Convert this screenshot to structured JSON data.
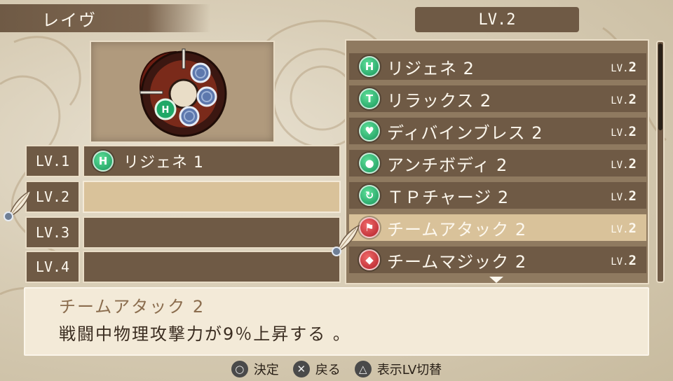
{
  "header": {
    "character_name": "レイヴ",
    "display_level": "LV.2"
  },
  "emblem": {
    "name": "skill-emblem",
    "slot_icon": "H"
  },
  "level_slots": [
    {
      "level": "LV.1",
      "skill": "リジェネ 1",
      "icon": "H",
      "icon_color": "#1fa866"
    },
    {
      "level": "LV.2",
      "skill": "",
      "icon": "",
      "selected": true
    },
    {
      "level": "LV.3",
      "skill": "",
      "icon": ""
    },
    {
      "level": "LV.4",
      "skill": "",
      "icon": ""
    }
  ],
  "skill_list": [
    {
      "name": "リジェネ 2",
      "icon": "H",
      "lv_prefix": "LV.",
      "lv": "2",
      "color": "#1fa866"
    },
    {
      "name": "リラックス 2",
      "icon": "T",
      "lv_prefix": "LV.",
      "lv": "2",
      "color": "#1fa866"
    },
    {
      "name": "ディバインブレス 2",
      "icon": "♥",
      "lv_prefix": "LV.",
      "lv": "2",
      "color": "#1fa866"
    },
    {
      "name": "アンチボディ 2",
      "icon": "●",
      "lv_prefix": "LV.",
      "lv": "2",
      "color": "#1fa866"
    },
    {
      "name": "ＴＰチャージ 2",
      "icon": "↻",
      "lv_prefix": "LV.",
      "lv": "2",
      "color": "#1fa866"
    },
    {
      "name": "チームアタック 2",
      "icon": "⚑",
      "lv_prefix": "LV.",
      "lv": "2",
      "color": "#c0262e",
      "selected": true
    },
    {
      "name": "チームマジック 2",
      "icon": "◆",
      "lv_prefix": "LV.",
      "lv": "2",
      "color": "#c0262e"
    }
  ],
  "description": {
    "title": "チームアタック 2",
    "text": "戦闘中物理攻撃力が9％上昇する 。"
  },
  "controls": [
    {
      "glyph": "○",
      "label": "決定"
    },
    {
      "glyph": "✕",
      "label": "戻る"
    },
    {
      "glyph": "△",
      "label": "表示LV切替"
    }
  ],
  "colors": {
    "panel_dark": "#6f5a45",
    "panel_selected": "#d9c29a",
    "icon_green": "#1fa866",
    "icon_red": "#c0262e",
    "background": "#d8cdb6"
  }
}
